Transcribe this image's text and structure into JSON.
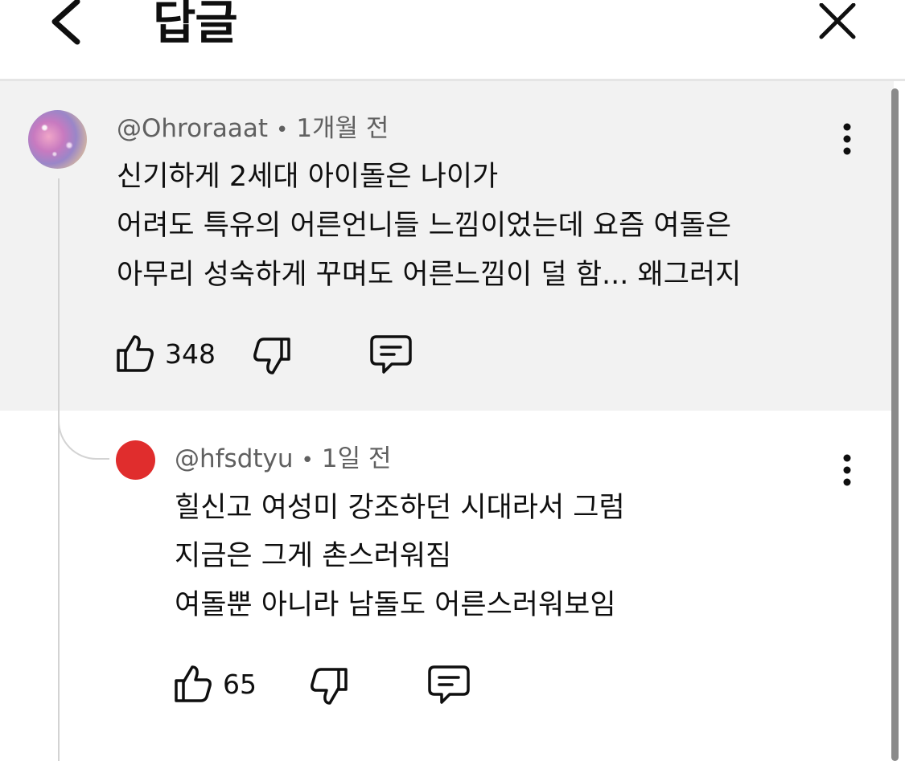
{
  "header": {
    "title": "답글",
    "back_icon": "chevron-left-icon",
    "close_icon": "close-icon"
  },
  "parent_comment": {
    "author": "@Ohroraaat",
    "separator": "•",
    "time": "1개월 전",
    "lines": [
      "신기하게 2세대 아이돌은 나이가",
      "어려도 특유의 어른언니들 느낌이었는데 요즘 여돌은",
      "아무리 성숙하게 꾸며도 어른느낌이 덜 함... 왜그러지"
    ],
    "likes": "348"
  },
  "reply": {
    "author": "@hfsdtyu",
    "separator": "•",
    "time": "1일 전",
    "lines": [
      "힐신고 여성미 강조하던 시대라서 그럼",
      "지금은 그게 촌스러워짐",
      "여돌뿐 아니라 남돌도 어른스러워보임"
    ],
    "likes": "65"
  },
  "colors": {
    "background": "#ffffff",
    "highlight": "#f2f2f2",
    "meta_text": "#606060",
    "avatar_red": "#e02d2d"
  }
}
